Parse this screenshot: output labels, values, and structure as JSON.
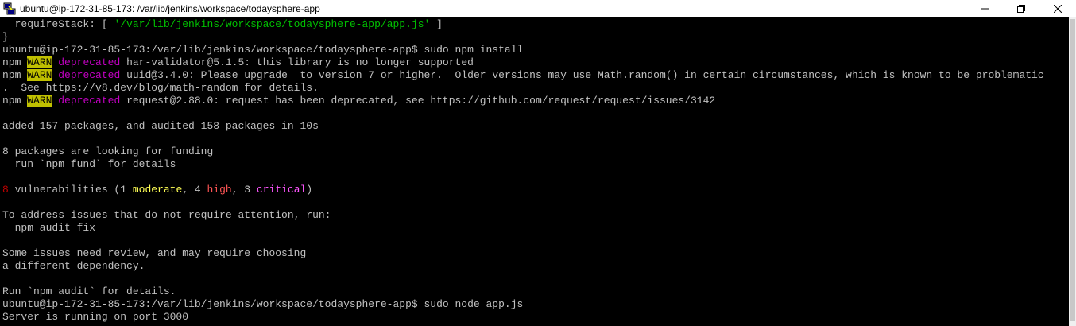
{
  "window": {
    "title": "ubuntu@ip-172-31-85-173: /var/lib/jenkins/workspace/todaysphere-app",
    "icon": "putty-icon",
    "controls": [
      "minimize-icon",
      "maximize-icon",
      "close-icon"
    ]
  },
  "colors": {
    "background": "#000000",
    "text": "#c0c0c0",
    "warn_bg": "#c0c000",
    "deprecated": "#c000c0",
    "string": "#00c000",
    "vuln_count": "#c00000",
    "moderate": "#ffff55",
    "high": "#ff5555",
    "critical": "#ff55ff"
  },
  "terminal": {
    "l01": {
      "a": "  requireStack: [ ",
      "b": "'/var/lib/jenkins/workspace/todaysphere-app/app.js'",
      "c": " ]"
    },
    "l02": "}",
    "l03": "ubuntu@ip-172-31-85-173:/var/lib/jenkins/workspace/todaysphere-app$ sudo npm install",
    "l04": {
      "npm": "npm ",
      "warn": "WARN",
      "dep": " deprecated",
      "rest": " har-validator@5.1.5: this library is no longer supported"
    },
    "l05": {
      "npm": "npm ",
      "warn": "WARN",
      "dep": " deprecated",
      "rest": " uuid@3.4.0: Please upgrade  to version 7 or higher.  Older versions may use Math.random() in certain circumstances, which is known to be problematic"
    },
    "l06": ".  See https://v8.dev/blog/math-random for details.",
    "l07": {
      "npm": "npm ",
      "warn": "WARN",
      "dep": " deprecated",
      "rest": " request@2.88.0: request has been deprecated, see https://github.com/request/request/issues/3142"
    },
    "l08": "",
    "l09": "added 157 packages, and audited 158 packages in 10s",
    "l10": "",
    "l11": "8 packages are looking for funding",
    "l12": "  run `npm fund` for details",
    "l13": "",
    "l14": {
      "count": "8",
      "t1": " vulnerabilities (1 ",
      "moderate": "moderate",
      "t2": ", 4 ",
      "high": "high",
      "t3": ", 3 ",
      "critical": "critical",
      "t4": ")"
    },
    "l15": "",
    "l16": "To address issues that do not require attention, run:",
    "l17": "  npm audit fix",
    "l18": "",
    "l19": "Some issues need review, and may require choosing",
    "l20": "a different dependency.",
    "l21": "",
    "l22": "Run `npm audit` for details.",
    "l23": "ubuntu@ip-172-31-85-173:/var/lib/jenkins/workspace/todaysphere-app$ sudo node app.js",
    "l24": "Server is running on port 3000"
  }
}
